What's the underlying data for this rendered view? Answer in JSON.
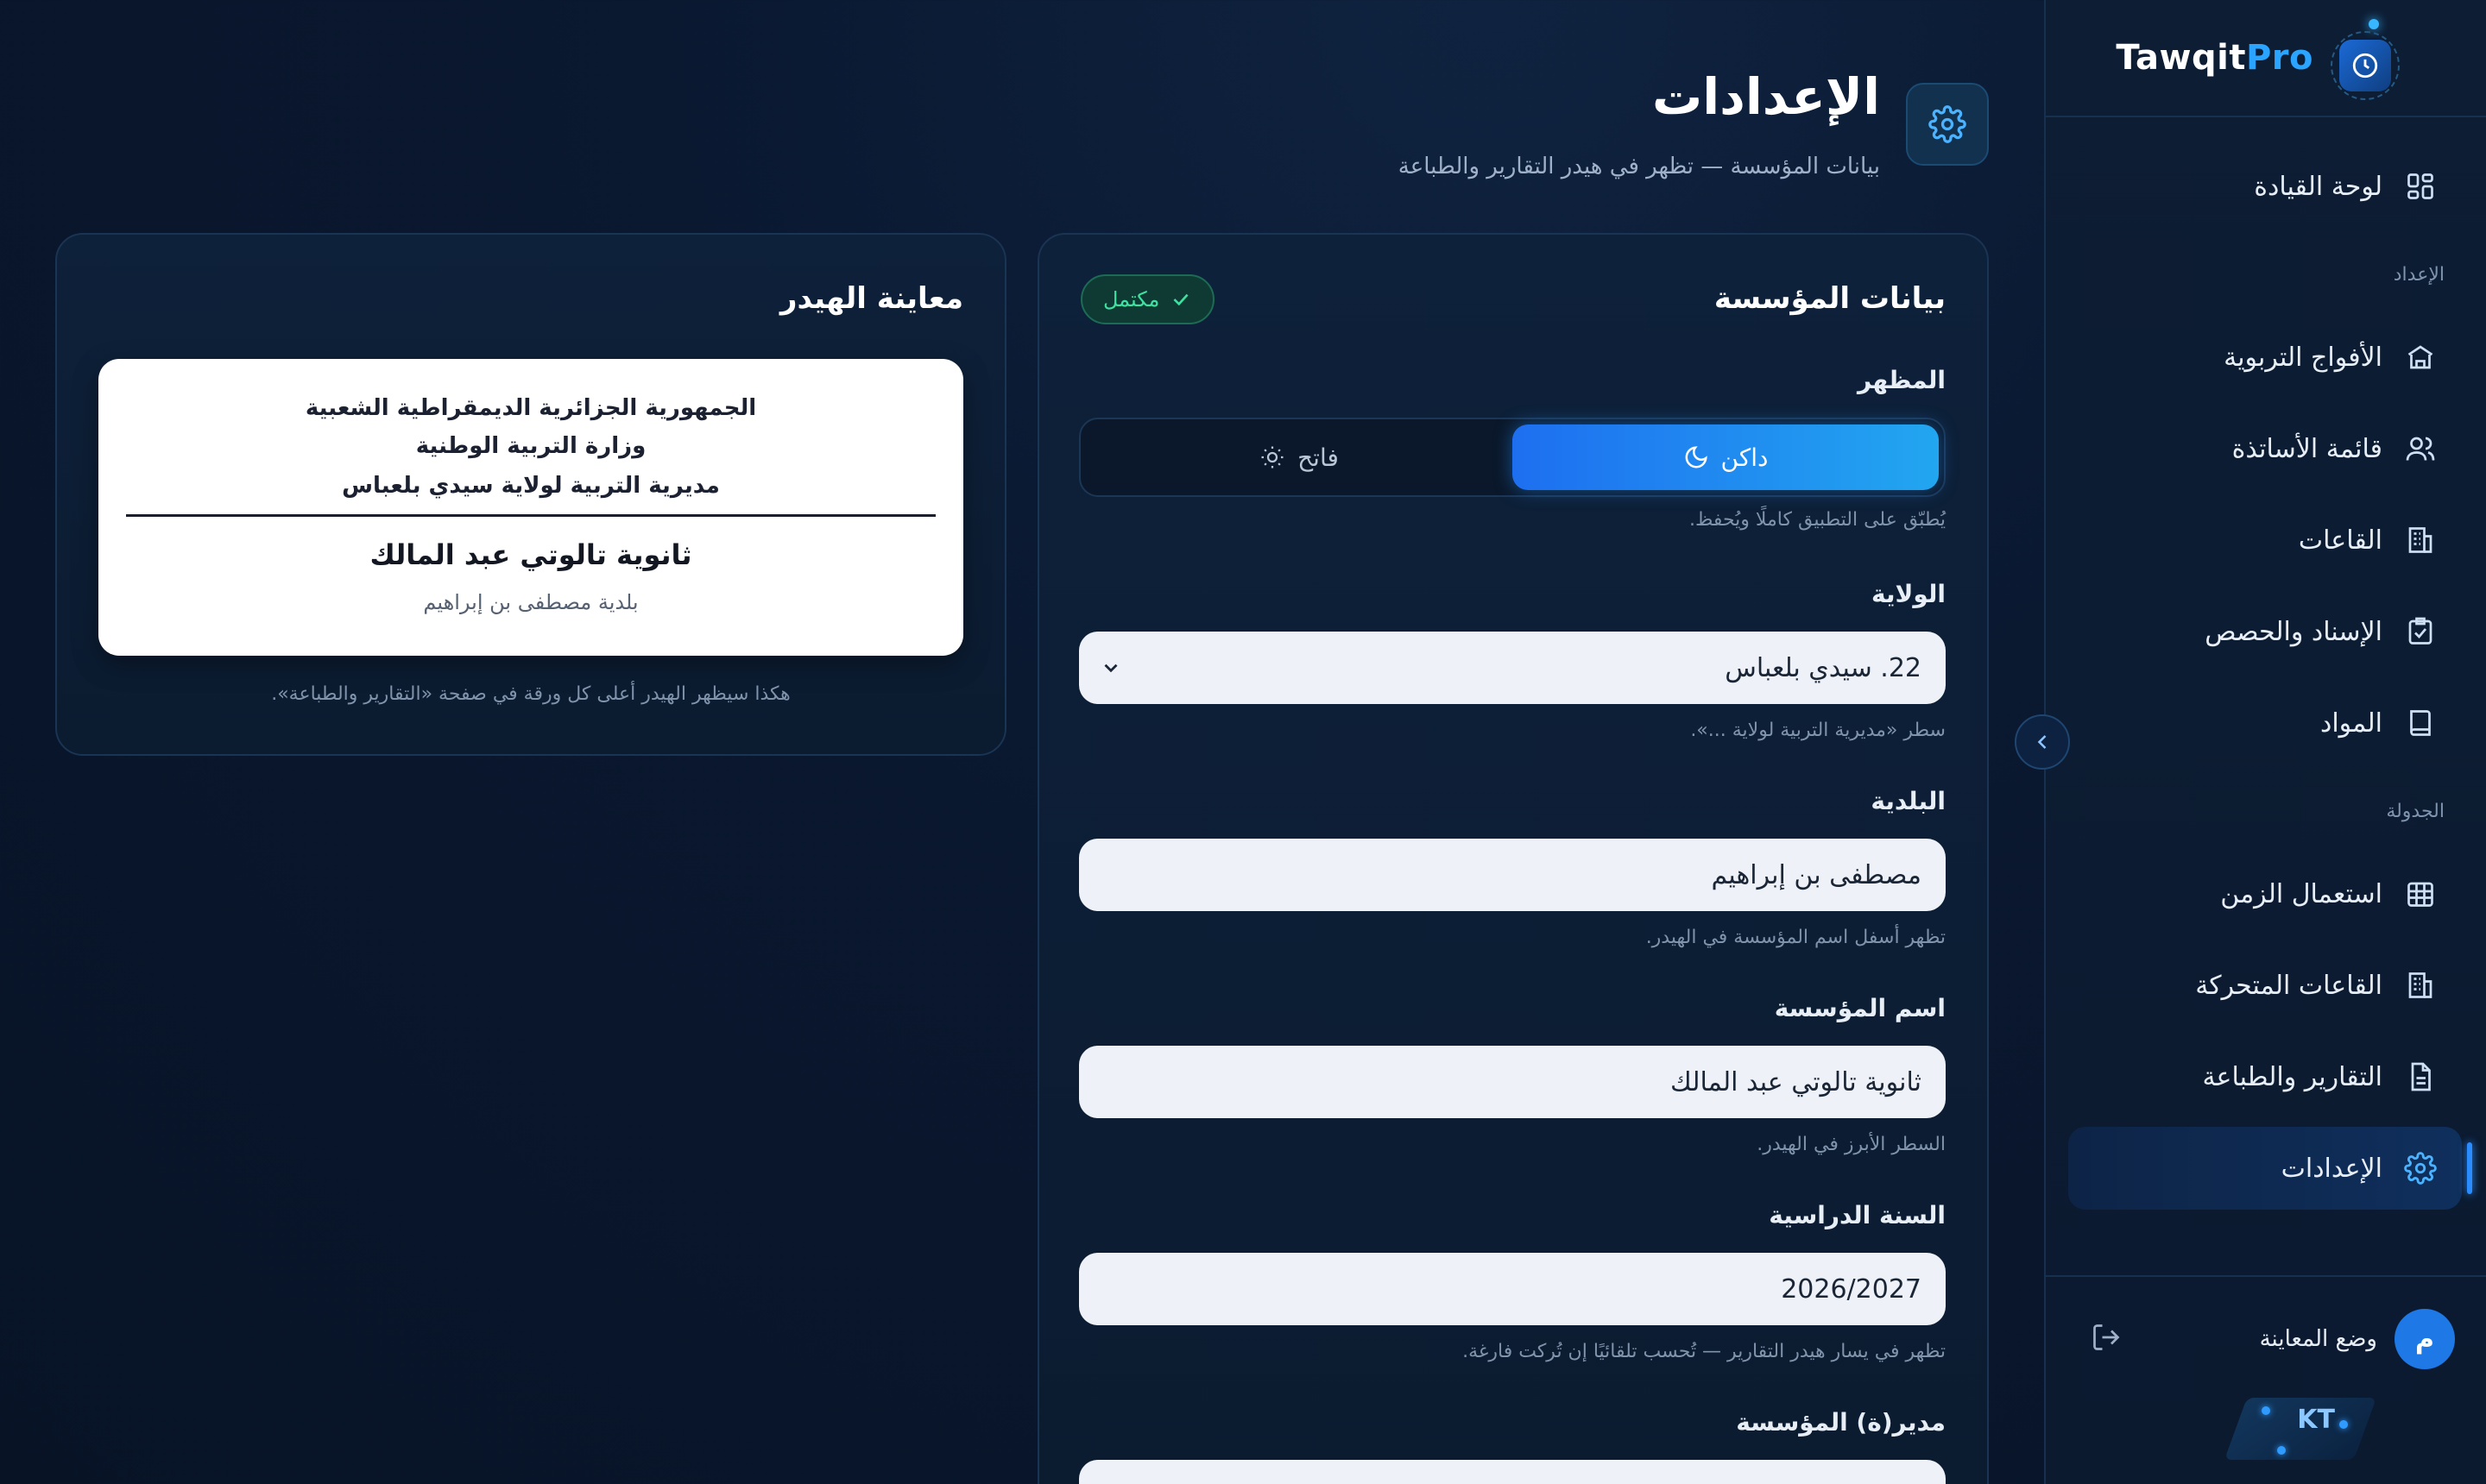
{
  "brand": {
    "name_part1": "Tawqit",
    "name_part2": "Pro"
  },
  "sidebar": {
    "items": [
      {
        "label": "لوحة القيادة",
        "icon": "dashboard-icon"
      },
      {
        "label": "الأفواج التربوية",
        "icon": "school-icon"
      },
      {
        "label": "قائمة الأساتذة",
        "icon": "users-icon"
      },
      {
        "label": "القاعات",
        "icon": "building-icon"
      },
      {
        "label": "الإسناد والحصص",
        "icon": "clipboard-check-icon"
      },
      {
        "label": "المواد",
        "icon": "book-icon"
      },
      {
        "label": "استعمال الزمن",
        "icon": "grid-icon"
      },
      {
        "label": "القاعات المتحركة",
        "icon": "building-icon"
      },
      {
        "label": "التقارير والطباعة",
        "icon": "file-text-icon"
      },
      {
        "label": "الإعدادات",
        "icon": "gear-icon",
        "active": true
      }
    ],
    "sections": {
      "setup": "الإعداد",
      "schedule": "الجدولة"
    },
    "user": {
      "avatar_letter": "م",
      "mode_label": "وضع المعاينة"
    },
    "badge": "KT"
  },
  "header": {
    "title": "الإعدادات",
    "subtitle": "بيانات المؤسسة — تظهر في هيدر التقارير والطباعة"
  },
  "form": {
    "title": "بيانات المؤسسة",
    "status": "مكتمل",
    "appearance": {
      "label": "المظهر",
      "dark": "داكن",
      "light": "فاتح",
      "hint": "يُطبّق على التطبيق كاملًا ويُحفظ."
    },
    "wilaya": {
      "label": "الولاية",
      "value": "22. سيدي بلعباس",
      "hint": "سطر «مديرية التربية لولاية ...»."
    },
    "commune": {
      "label": "البلدية",
      "value": "مصطفى بن إبراهيم",
      "hint": "تظهر أسفل اسم المؤسسة في الهيدر."
    },
    "institution": {
      "label": "اسم المؤسسة",
      "value": "ثانوية تالوتي عبد المالك",
      "hint": "السطر الأبرز في الهيدر."
    },
    "school_year": {
      "label": "السنة الدراسية",
      "value": "2026/2027",
      "hint": "تظهر في يسار هيدر التقارير — تُحسب تلقائيًا إن تُركت فارغة."
    },
    "director": {
      "label": "مدير(ة) المؤسسة",
      "value": ""
    }
  },
  "preview": {
    "title": "معاينة الهيدر",
    "line1": "الجمهورية الجزائرية الديمقراطية الشعبية",
    "line2": "وزارة التربية الوطنية",
    "line3": "مديرية التربية لولاية سيدي بلعباس",
    "institution": "ثانوية تالوتي عبد المالك",
    "municipality": "بلدية مصطفى بن إبراهيم",
    "caption": "هكذا سيظهر الهيدر أعلى كل ورقة في صفحة «التقارير والطباعة»."
  },
  "colors": {
    "accent": "#1e6ff0",
    "success": "#3fe0a0",
    "brand_blue": "#2aa4ff"
  }
}
